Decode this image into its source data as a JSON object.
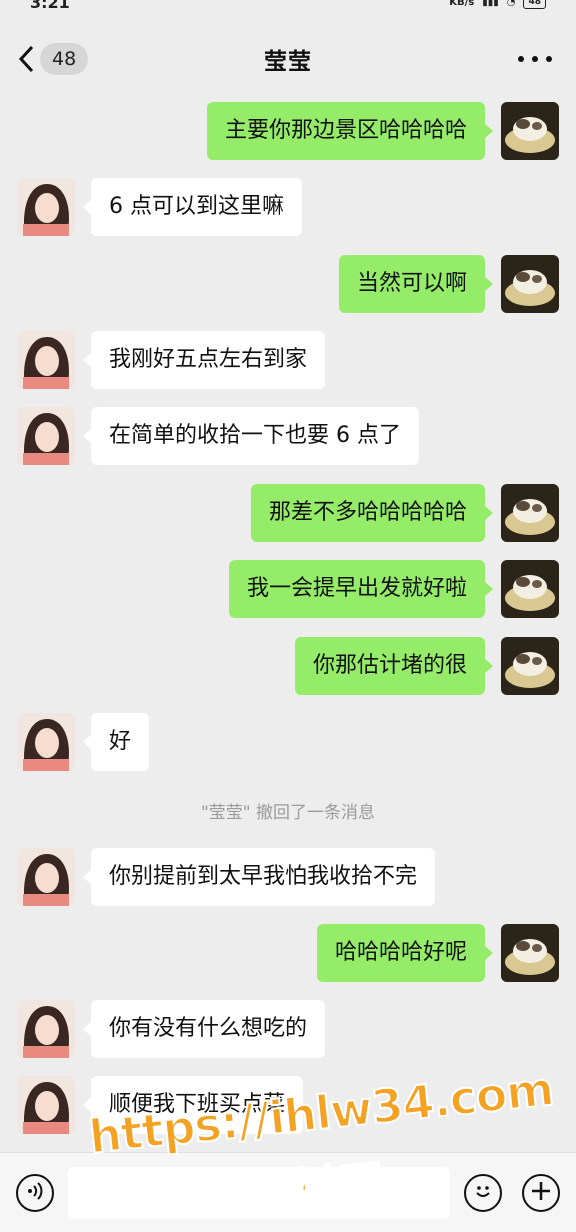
{
  "status_bar": {
    "time": "3:21",
    "network": "KB/s",
    "battery": "48"
  },
  "header": {
    "back_count": "48",
    "title": "莹莹"
  },
  "messages": [
    {
      "side": "right",
      "text": "主要你那边景区哈哈哈哈"
    },
    {
      "side": "left",
      "text": "6 点可以到这里嘛"
    },
    {
      "side": "right",
      "text": "当然可以啊"
    },
    {
      "side": "left",
      "text": "我刚好五点左右到家"
    },
    {
      "side": "left",
      "text": "在简单的收拾一下也要 6 点了"
    },
    {
      "side": "right",
      "text": "那差不多哈哈哈哈哈"
    },
    {
      "side": "right",
      "text": "我一会提早出发就好啦"
    },
    {
      "side": "right",
      "text": "你那估计堵的很"
    },
    {
      "side": "left",
      "text": "好"
    },
    {
      "side": "system",
      "text": "\"莹莹\" 撤回了一条消息"
    },
    {
      "side": "left",
      "text": "你别提前到太早我怕我收拾不完"
    },
    {
      "side": "right",
      "text": "哈哈哈哈好呢"
    },
    {
      "side": "left",
      "text": "你有没有什么想吃的"
    },
    {
      "side": "left",
      "text": "顺便我下班买点菜"
    }
  ],
  "input": {
    "value": ""
  },
  "icons": {
    "back": "chevron-left-icon",
    "more": "more-dots-icon",
    "voice": "voice-icon",
    "emoji": "emoji-icon",
    "plus": "plus-icon"
  },
  "watermark": {
    "line1": "https://ihlw34.com",
    "line2": "黑料网"
  },
  "colors": {
    "sent_bubble": "#95ec69",
    "received_bubble": "#ffffff",
    "background": "#ededed",
    "watermark": "#f4a224"
  }
}
